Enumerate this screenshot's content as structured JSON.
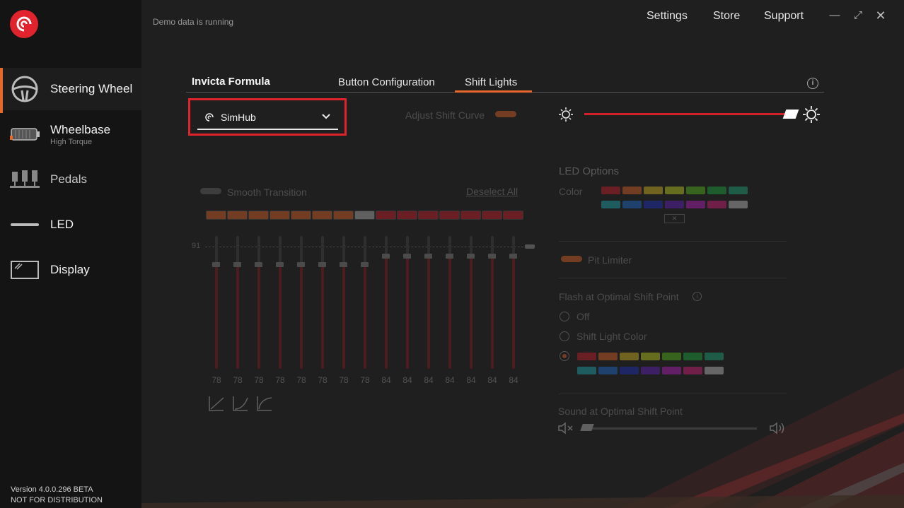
{
  "app": {
    "status": "Demo data is running",
    "version": "Version 4.0.0.296 BETA",
    "distribution": "NOT FOR DISTRIBUTION"
  },
  "top_nav": {
    "settings": "Settings",
    "store": "Store",
    "support": "Support"
  },
  "sidebar": {
    "items": [
      {
        "label": "Steering Wheel",
        "sub": "",
        "icon": "steering-wheel-icon",
        "active": true
      },
      {
        "label": "Wheelbase",
        "sub": "High Torque",
        "icon": "wheelbase-icon",
        "active": false
      },
      {
        "label": "Pedals",
        "sub": "",
        "icon": "pedals-icon",
        "active": false
      },
      {
        "label": "LED",
        "sub": "",
        "icon": "led-icon",
        "active": false
      },
      {
        "label": "Display",
        "sub": "",
        "icon": "display-icon",
        "active": false
      }
    ]
  },
  "product": {
    "title": "Invicta Formula"
  },
  "tabs": [
    {
      "label": "Button Configuration",
      "selected": false
    },
    {
      "label": "Shift Lights",
      "selected": true
    }
  ],
  "profile": {
    "selected": "SimHub"
  },
  "shift_lights": {
    "adjust_shift_curve": "Adjust Shift Curve",
    "brightness": 0.98,
    "smooth_transition": "Smooth Transition",
    "deselect_all": "Deselect All",
    "threshold_label": "91",
    "faders": [
      78,
      78,
      78,
      78,
      78,
      78,
      78,
      78,
      84,
      84,
      84,
      84,
      84,
      84,
      84
    ],
    "led_colors": [
      "#e8682a",
      "#e8682a",
      "#e8682a",
      "#e8682a",
      "#e8682a",
      "#e8682a",
      "#e8682a",
      "#bbbbbb",
      "#d0202a",
      "#d0202a",
      "#d0202a",
      "#d0202a",
      "#d0202a",
      "#d0202a",
      "#d0202a"
    ]
  },
  "led_options": {
    "title": "LED Options",
    "color_label": "Color",
    "pit_limiter": "Pit Limiter",
    "flash_title": "Flash at Optimal Shift Point",
    "flash_options": [
      "Off",
      "Shift Light Color"
    ],
    "sound_title": "Sound at Optimal Shift Point",
    "palette_row1": [
      "#d0202a",
      "#e8682a",
      "#e0c020",
      "#c8d820",
      "#58c020",
      "#20b040",
      "#20b080"
    ],
    "palette_row2": [
      "#20b0b8",
      "#2070d8",
      "#2030c8",
      "#6820c8",
      "#c020c8",
      "#e02080",
      "#c8c8c8"
    ],
    "accent": "#e8682a"
  }
}
